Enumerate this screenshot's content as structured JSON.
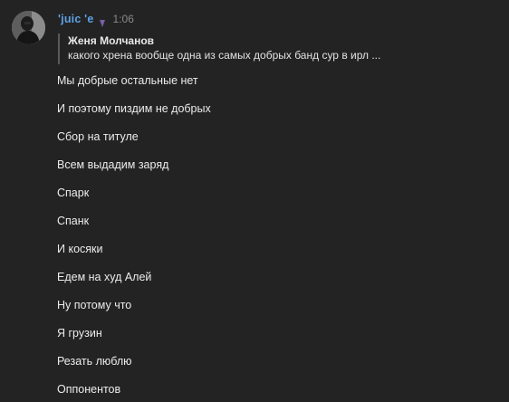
{
  "message": {
    "author": {
      "name": "'juic 'e",
      "avatar": "avatar"
    },
    "time": "1:06",
    "badge_icon": "verified-badge-icon",
    "reply": {
      "author": "Женя Молчанов",
      "text": "какого хрена вообще одна из самых добрых банд сур в ирл ..."
    },
    "lines": [
      "Мы добрые остальные нет",
      "И поэтому пиздим не добрых",
      "Сбор на титуле",
      "Всем выдадим заряд",
      "Спарк",
      "Спанк",
      "И косяки",
      "Едем на худ Алей",
      "Ну потому что",
      "Я грузин",
      "Резать люблю",
      "Оппонентов"
    ]
  },
  "colors": {
    "background": "#232323",
    "username": "#5ea1e6",
    "timestamp": "#8a8a8a",
    "text": "#ececec",
    "reply_bar": "#5a5a5a"
  }
}
